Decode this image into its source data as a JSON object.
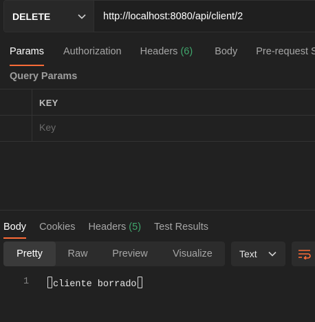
{
  "request": {
    "method": "DELETE",
    "url": "http://localhost:8080/api/client/2"
  },
  "request_tabs": [
    {
      "label": "Params",
      "active": true
    },
    {
      "label": "Authorization"
    },
    {
      "label": "Headers",
      "count": "(6)"
    },
    {
      "label": "Body"
    },
    {
      "label": "Pre-request S"
    }
  ],
  "query_params": {
    "title": "Query Params",
    "key_header": "KEY",
    "key_placeholder": "Key"
  },
  "response_tabs": [
    {
      "label": "Body",
      "active": true
    },
    {
      "label": "Cookies"
    },
    {
      "label": "Headers",
      "count": "(5)"
    },
    {
      "label": "Test Results"
    }
  ],
  "view_modes": [
    {
      "label": "Pretty",
      "active": true
    },
    {
      "label": "Raw"
    },
    {
      "label": "Preview"
    },
    {
      "label": "Visualize"
    }
  ],
  "format_select": {
    "value": "Text"
  },
  "response_body": {
    "line_number": "1",
    "text": "cliente borrado"
  },
  "icons": {
    "method_dropdown": "chevron-down-icon",
    "format_dropdown": "chevron-down-icon",
    "wrap": "wrap-lines-icon"
  },
  "colors": {
    "accent": "#ff6c37",
    "count": "#40a66c",
    "background": "#212121"
  }
}
